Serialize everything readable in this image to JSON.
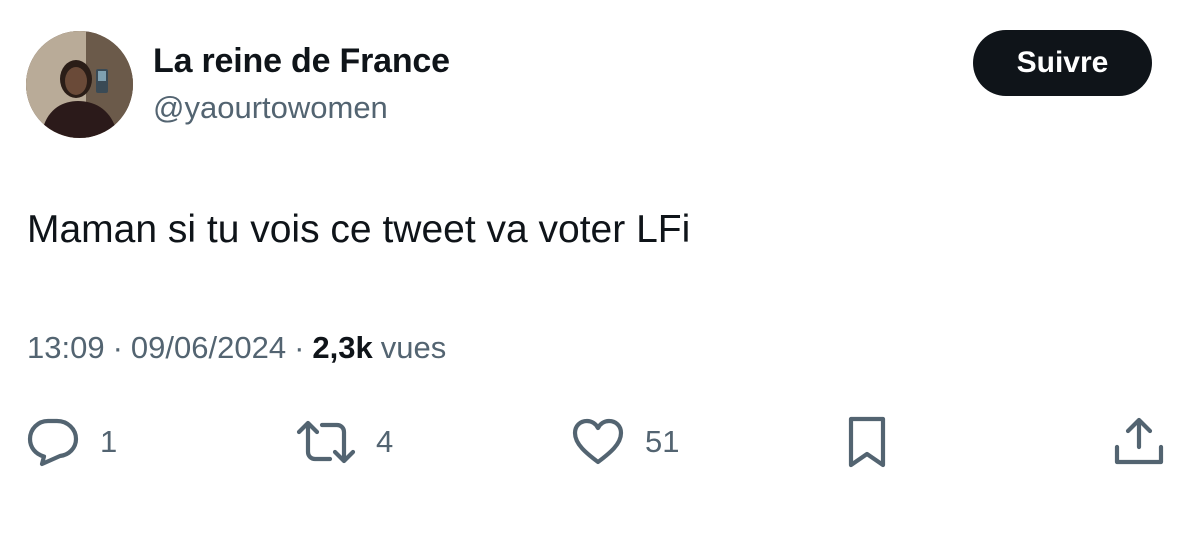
{
  "author": {
    "display_name": "La reine de France",
    "handle": "@yaourtowomen"
  },
  "follow_button": {
    "label": "Suivre"
  },
  "tweet": {
    "text": "Maman si tu vois ce tweet va voter LFi",
    "time": "13:09",
    "separator": "·",
    "date": "09/06/2024",
    "views_count": "2,3k",
    "views_label": "vues"
  },
  "actions": {
    "reply_count": "1",
    "retweet_count": "4",
    "like_count": "51"
  },
  "icons": {
    "reply": "reply-bubble-icon",
    "retweet": "retweet-arrows-icon",
    "like": "heart-icon",
    "bookmark": "bookmark-icon",
    "share": "share-upload-icon"
  },
  "colors": {
    "text_primary": "#0f1419",
    "text_secondary": "#536471",
    "button_bg": "#0f1419",
    "button_text": "#ffffff",
    "background": "#ffffff"
  }
}
